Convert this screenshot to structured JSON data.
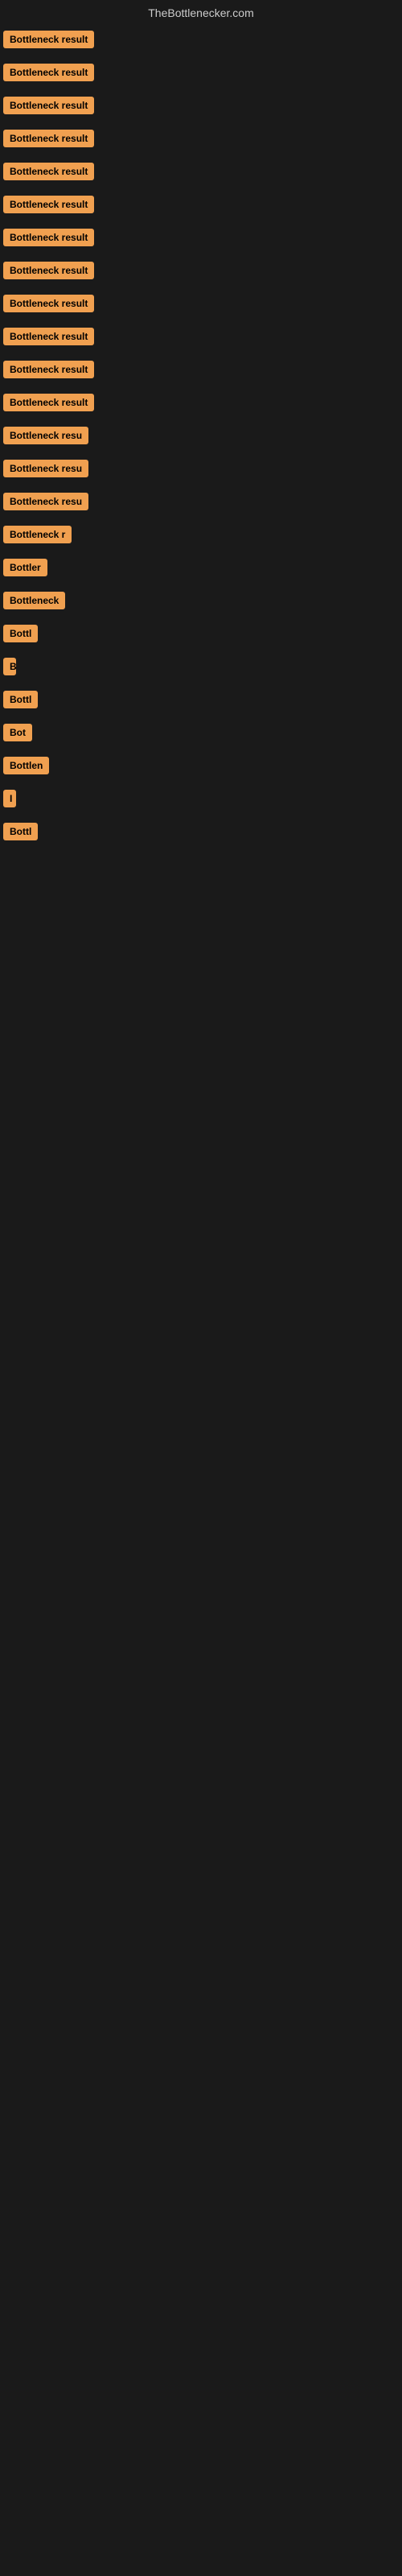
{
  "header": {
    "title": "TheBottlenecker.com"
  },
  "results": [
    {
      "label": "Bottleneck result",
      "width": 160
    },
    {
      "label": "Bottleneck result",
      "width": 160
    },
    {
      "label": "Bottleneck result",
      "width": 160
    },
    {
      "label": "Bottleneck result",
      "width": 160
    },
    {
      "label": "Bottleneck result",
      "width": 160
    },
    {
      "label": "Bottleneck result",
      "width": 160
    },
    {
      "label": "Bottleneck result",
      "width": 160
    },
    {
      "label": "Bottleneck result",
      "width": 160
    },
    {
      "label": "Bottleneck result",
      "width": 160
    },
    {
      "label": "Bottleneck result",
      "width": 160
    },
    {
      "label": "Bottleneck result",
      "width": 160
    },
    {
      "label": "Bottleneck result",
      "width": 160
    },
    {
      "label": "Bottleneck resu",
      "width": 130
    },
    {
      "label": "Bottleneck resu",
      "width": 130
    },
    {
      "label": "Bottleneck resu",
      "width": 130
    },
    {
      "label": "Bottleneck r",
      "width": 100
    },
    {
      "label": "Bottler",
      "width": 60
    },
    {
      "label": "Bottleneck",
      "width": 90
    },
    {
      "label": "Bottl",
      "width": 50
    },
    {
      "label": "B",
      "width": 16
    },
    {
      "label": "Bottl",
      "width": 50
    },
    {
      "label": "Bot",
      "width": 36
    },
    {
      "label": "Bottlen",
      "width": 65
    },
    {
      "label": "I",
      "width": 10
    },
    {
      "label": "Bottl",
      "width": 50
    }
  ]
}
